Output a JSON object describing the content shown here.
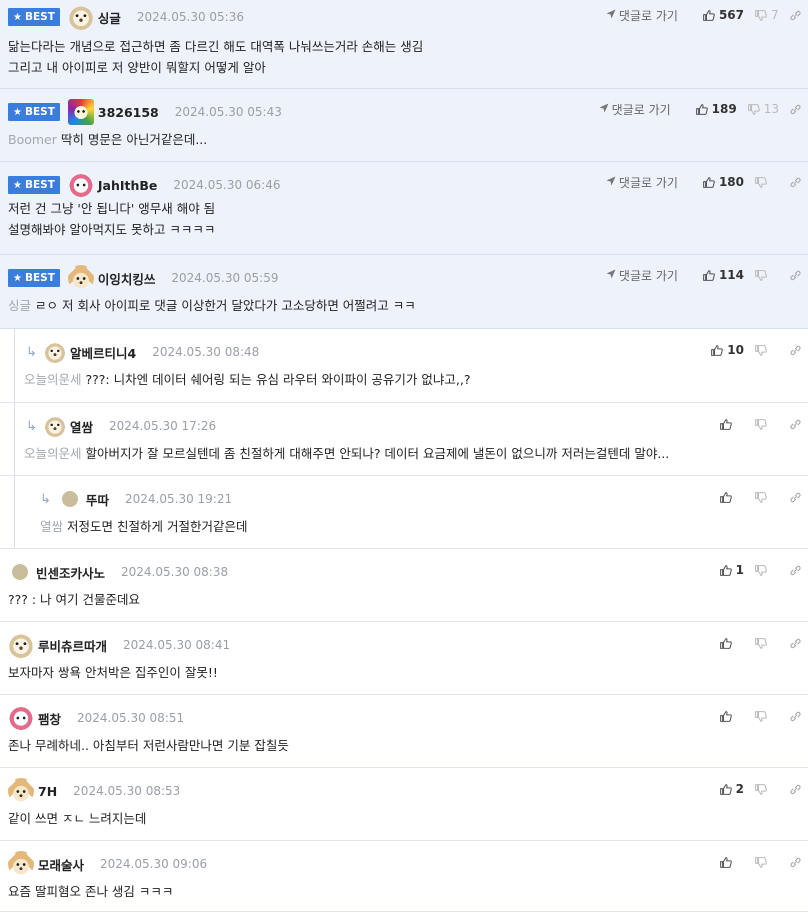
{
  "labels": {
    "best": "BEST",
    "goto_reply": "댓글로 가기"
  },
  "colors": {
    "best_badge": "#3b7ddd",
    "best_background": "#eef3fb",
    "mention": "#a3a8ae",
    "date": "#9a9fa6"
  },
  "comments": [
    {
      "type": "best",
      "avatar": "dog-icon",
      "nick": "싱글",
      "date": "2024.05.30 05:36",
      "likes": "567",
      "dislikes": "7",
      "mention": "",
      "lines": [
        "닮는다라는 개념으로 접근하면 좀 다르긴 해도 대역폭 나눠쓰는거라 손해는 생김",
        "그리고 내 아이피로 저 양반이 뭐할지 어떻게 알아"
      ]
    },
    {
      "type": "best",
      "avatar": "rainbow-icon",
      "nick": "3826158",
      "date": "2024.05.30 05:43",
      "likes": "189",
      "dislikes": "13",
      "mention": "Boomer",
      "lines": [
        "딱히 명문은 아닌거같은데..."
      ]
    },
    {
      "type": "best",
      "avatar": "pink-icon",
      "nick": "JahIthBe",
      "date": "2024.05.30 06:46",
      "likes": "180",
      "dislikes": "",
      "mention": "",
      "lines": [
        "저런 건 그냥 '안 됩니다' 앵무새 해야 됨",
        "설명해봐야 알아먹지도 못하고 ㅋㅋㅋㅋ"
      ]
    },
    {
      "type": "best",
      "avatar": "fox-icon",
      "nick": "이잉치킹쓰",
      "date": "2024.05.30 05:59",
      "likes": "114",
      "dislikes": "",
      "mention": "싱글",
      "lines": [
        "ㄹㅇ 저 회사 아이피로 댓글 이상한거 달았다가 고소당하면 어쩔려고 ㅋㅋ"
      ]
    },
    {
      "type": "reply",
      "avatar": "dog-icon",
      "nick": "알베르티니4",
      "date": "2024.05.30 08:48",
      "likes": "10",
      "dislikes": "",
      "mention": "오늘의운세",
      "lines": [
        "???: 니차엔 데이터 쉐어링 되는 유심 라우터 와이파이 공유기가 없냐고,,?"
      ]
    },
    {
      "type": "reply",
      "avatar": "dog-icon",
      "nick": "열쌈",
      "date": "2024.05.30 17:26",
      "likes": "",
      "dislikes": "",
      "mention": "오늘의운세",
      "lines": [
        "할아버지가 잘 모르실텐데 좀 친절하게 대해주면 안되나? 데이터 요금제에 낼돈이 없으니까 저러는걸텐데 말야..."
      ]
    },
    {
      "type": "reply2",
      "avatar": "dot",
      "nick": "뚜따",
      "date": "2024.05.30 19:21",
      "likes": "",
      "dislikes": "",
      "mention": "열쌈",
      "lines": [
        "저정도면 친절하게 거절한거같은데"
      ]
    },
    {
      "type": "normal",
      "avatar": "dot",
      "nick": "빈센조카사노",
      "date": "2024.05.30 08:38",
      "likes": "1",
      "dislikes": "",
      "mention": "",
      "lines": [
        "??? : 나 여기 건물준데요"
      ]
    },
    {
      "type": "normal",
      "avatar": "dog-icon",
      "nick": "루비츄르따개",
      "date": "2024.05.30 08:41",
      "likes": "",
      "dislikes": "",
      "mention": "",
      "lines": [
        "보자마자 쌍욕 안처박은 집주인이 잘못!!"
      ]
    },
    {
      "type": "normal",
      "avatar": "pink-icon",
      "nick": "팸창",
      "date": "2024.05.30 08:51",
      "likes": "",
      "dislikes": "",
      "mention": "",
      "lines": [
        "존나 무례하네.. 아침부터 저런사람만나면 기분 잡칠듯"
      ]
    },
    {
      "type": "normal",
      "avatar": "fox-icon",
      "nick": "7H",
      "date": "2024.05.30 08:53",
      "likes": "2",
      "dislikes": "",
      "mention": "",
      "lines": [
        "같이 쓰면 ㅈㄴ 느려지는데"
      ]
    },
    {
      "type": "normal",
      "avatar": "fox-icon",
      "nick": "모래술사",
      "date": "2024.05.30 09:06",
      "likes": "",
      "dislikes": "",
      "mention": "",
      "lines": [
        "요즘 딸피혐오 존나 생김 ㅋㅋㅋ"
      ]
    }
  ]
}
